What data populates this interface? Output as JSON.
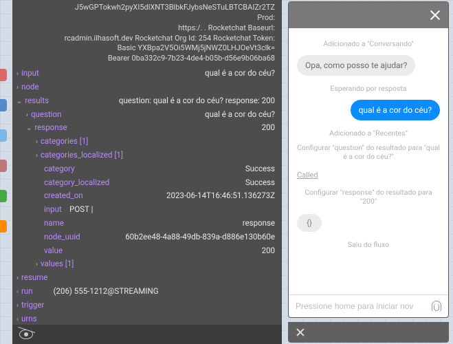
{
  "colors": {
    "accent": "#0a8cff",
    "key": "#bb8aff"
  },
  "left_tabs": [
    "#d66",
    "#58c",
    "#7bb6e8",
    "#b77",
    "#4a4",
    "#f80"
  ],
  "debug": {
    "header_block": "J5wGPTokwh2pyXI5dlXNT3BlbkFJybsNeSTuLBTCBAIZr2TZ\nProd:\nhttps:/.                                       . Rocketchat Baseurl:\nrcadmin.ilhasoft.dev Rocketchat Org Id: 254 Rocketchat Token:\nBasic YXBpa2V5Oi5WMj5jNWZ0LHJOeVt3clk=\nBearer 0ba332c9-7b23-4de4-b05b-d56e9b06ba68",
    "rows": {
      "input": {
        "label": "input",
        "value": "qual é a cor do céu?"
      },
      "node": {
        "label": "node",
        "value": ""
      },
      "results": {
        "label": "results",
        "value": "question: qual é a cor do céu? response: 200"
      },
      "question": {
        "label": "question",
        "value": "qual é a cor do céu?"
      },
      "response": {
        "label": "response",
        "value": "200"
      },
      "categories": {
        "label": "categories",
        "count": "[1]"
      },
      "categories_localized": {
        "label": "categories_localized",
        "count": "[1]"
      },
      "category": {
        "label": "category",
        "value": "Success"
      },
      "category_localized": {
        "label": "category_localized",
        "value": "Success"
      },
      "created_on": {
        "label": "created_on",
        "value": "2023-06-14T16:46:51.136273Z"
      },
      "r_input": {
        "label": "input",
        "value": "POST |"
      },
      "name": {
        "label": "name",
        "value": "response"
      },
      "node_uuid": {
        "label": "node_uuid",
        "value": "60b2ee48-4a88-49db-839a-d886e130b60e"
      },
      "r_value": {
        "label": "value",
        "value": "200"
      },
      "values": {
        "label": "values",
        "count": "[1]"
      },
      "resume": {
        "label": "resume",
        "value": ""
      },
      "run": {
        "label": "run",
        "value": "(206) 555-1212@STREAMING"
      },
      "trigger": {
        "label": "trigger",
        "value": ""
      },
      "urns": {
        "label": "urns",
        "value": ""
      }
    }
  },
  "chat": {
    "sys_added_conversando": "Adicionado a \"Conversando\"",
    "bot_msg": "Opa, como posso te ajudar?",
    "sys_waiting": "Esperando por resposta",
    "user_msg": "qual é a cor do céu?",
    "sys_added_recentes": "Adicionado a \"Recentes\"",
    "sys_cfg_question": "Configurar \"question\" do resultado para \"qual é a cor do céu?\"",
    "called_link": "Called",
    "sys_cfg_response": "Configurar \"response\" do resultado para \"200\"",
    "code_bubble": "{}",
    "sys_exit": "Saiu do fluxo",
    "input_placeholder": "Pressione home para iniciar nov"
  }
}
